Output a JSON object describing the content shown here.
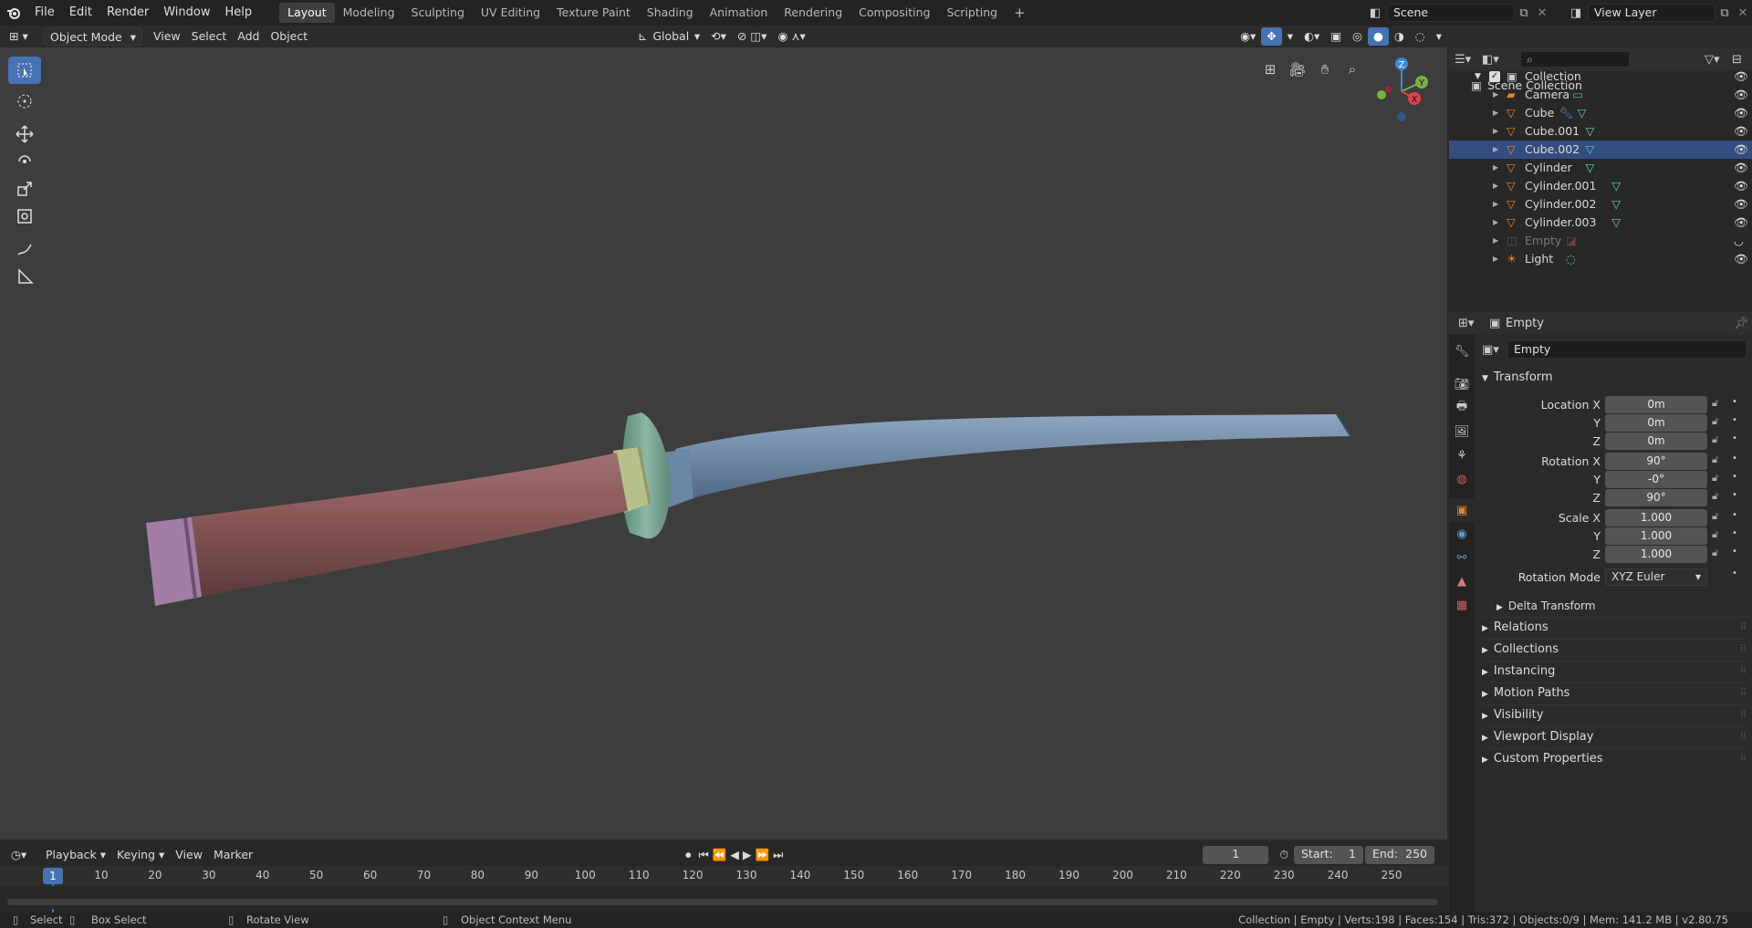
{
  "topbar": {
    "menus": [
      "File",
      "Edit",
      "Render",
      "Window",
      "Help"
    ],
    "workspaces": [
      {
        "label": "Layout",
        "active": true
      },
      {
        "label": "Modeling"
      },
      {
        "label": "Sculpting"
      },
      {
        "label": "UV Editing"
      },
      {
        "label": "Texture Paint"
      },
      {
        "label": "Shading"
      },
      {
        "label": "Animation"
      },
      {
        "label": "Rendering"
      },
      {
        "label": "Compositing"
      },
      {
        "label": "Scripting"
      }
    ],
    "add_workspace": "+",
    "scene": "Scene",
    "view_layer": "View Layer"
  },
  "viewport_header": {
    "mode": "Object Mode",
    "menus": [
      "View",
      "Select",
      "Add",
      "Object"
    ],
    "orientation": "Global"
  },
  "gizmo": {
    "x": "X",
    "y": "Y",
    "z": "Z"
  },
  "outliner": {
    "search_placeholder": "",
    "root": "Scene Collection",
    "collection": "Collection",
    "items": [
      {
        "name": "Camera",
        "type": "camera"
      },
      {
        "name": "Cube",
        "type": "mesh",
        "modifier": true
      },
      {
        "name": "Cube.001",
        "type": "mesh"
      },
      {
        "name": "Cube.002",
        "type": "mesh",
        "selected": true
      },
      {
        "name": "Cylinder",
        "type": "mesh"
      },
      {
        "name": "Cylinder.001",
        "type": "mesh"
      },
      {
        "name": "Cylinder.002",
        "type": "mesh"
      },
      {
        "name": "Cylinder.003",
        "type": "mesh"
      },
      {
        "name": "Empty",
        "type": "empty",
        "hidden": true
      },
      {
        "name": "Light",
        "type": "light"
      }
    ]
  },
  "properties": {
    "header_object": "Empty",
    "object_name": "Empty",
    "transform_title": "Transform",
    "location_label": "Location X",
    "rotation_label": "Rotation X",
    "scale_label": "Scale X",
    "y_label": "Y",
    "z_label": "Z",
    "location": [
      "0m",
      "0m",
      "0m"
    ],
    "rotation": [
      "90°",
      "-0°",
      "90°"
    ],
    "scale": [
      "1.000",
      "1.000",
      "1.000"
    ],
    "rotation_mode_label": "Rotation Mode",
    "rotation_mode": "XYZ Euler",
    "delta": "Delta Transform",
    "panels": [
      "Relations",
      "Collections",
      "Instancing",
      "Motion Paths",
      "Visibility",
      "Viewport Display",
      "Custom Properties"
    ]
  },
  "timeline": {
    "menus": [
      "Playback",
      "Keying",
      "View",
      "Marker"
    ],
    "current_frame": "1",
    "start_label": "Start:",
    "start": "1",
    "end_label": "End:",
    "end": "250",
    "ruler": [
      "1",
      "10",
      "20",
      "30",
      "40",
      "50",
      "60",
      "70",
      "80",
      "90",
      "100",
      "110",
      "120",
      "130",
      "140",
      "150",
      "160",
      "170",
      "180",
      "190",
      "200",
      "210",
      "220",
      "230",
      "240",
      "250"
    ]
  },
  "status": {
    "select": "Select",
    "box_select": "Box Select",
    "rotate_view": "Rotate View",
    "context_menu": "Object Context Menu",
    "stats": "Collection | Empty | Verts:198 | Faces:154 | Tris:372 | Objects:0/9 | Mem: 141.2 MB | v2.80.75"
  }
}
